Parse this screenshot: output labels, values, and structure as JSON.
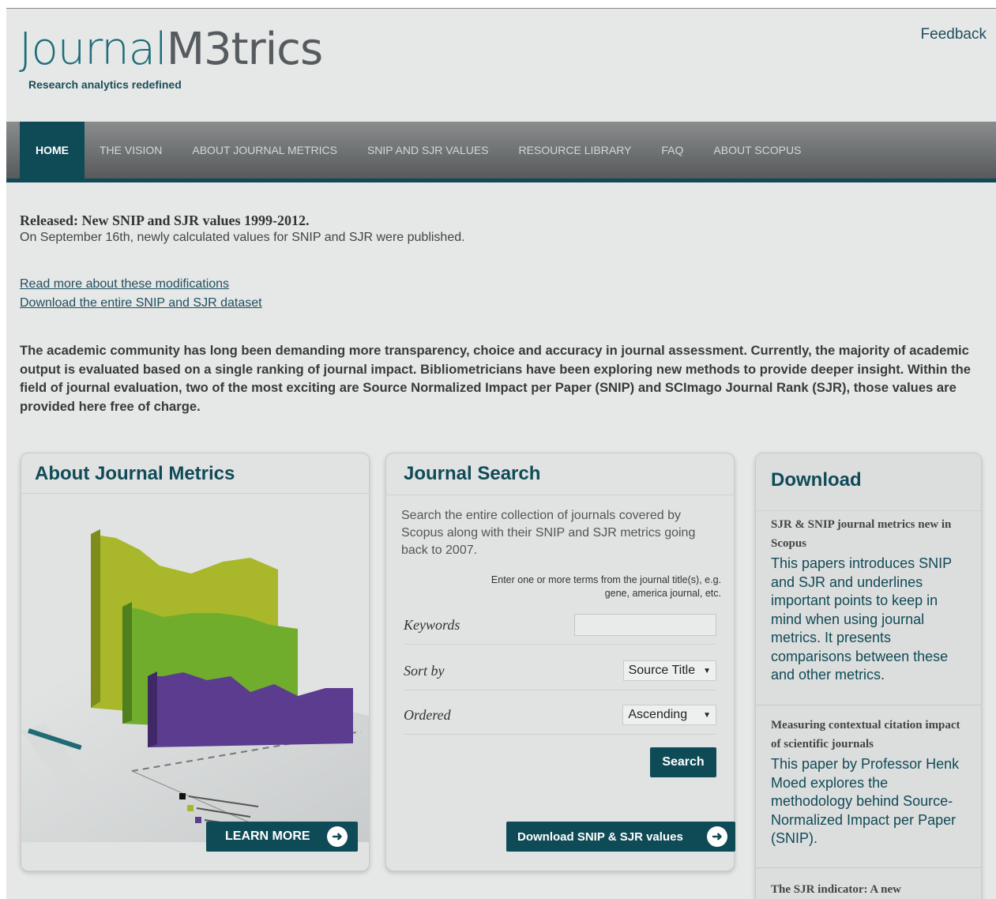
{
  "header": {
    "logo_part1": "Journal",
    "logo_part2": "M3trics",
    "tagline": "Research analytics redefined",
    "feedback": "Feedback"
  },
  "nav": {
    "items": [
      "HOME",
      "THE VISION",
      "ABOUT JOURNAL METRICS",
      "SNIP AND SJR VALUES",
      "RESOURCE LIBRARY",
      "FAQ",
      "ABOUT SCOPUS"
    ],
    "active": "HOME"
  },
  "intro": {
    "release_title": "Released: New SNIP and SJR values 1999-2012.",
    "release_text": "On September 16th, newly calculated values for SNIP and SJR were published.",
    "link1": "Read more about these modifications",
    "link2": "Download the entire SNIP and SJR dataset",
    "description": "The academic community has long been demanding more transparency, choice and accuracy in journal assessment. Currently, the majority of academic output is evaluated based on a single ranking of journal impact. Bibliometricians have been exploring new methods to provide deeper insight. Within the field of journal evaluation, two of the most exciting are Source Normalized Impact per Paper (SNIP) and SCImago Journal Rank (SJR), those values are provided here free of charge."
  },
  "about_panel": {
    "title": "About Journal Metrics",
    "button": "LEARN MORE"
  },
  "search_panel": {
    "title": "Journal Search",
    "description": "Search the entire collection of journals covered by Scopus along with their SNIP and SJR metrics going back to 2007.",
    "hint": "Enter one or more terms from the journal title(s), e.g. gene, america journal, etc.",
    "keywords_label": "Keywords",
    "keywords_value": "",
    "sortby_label": "Sort by",
    "sortby_value": "Source Title",
    "ordered_label": "Ordered",
    "ordered_value": "Ascending",
    "search_button": "Search",
    "download_button": "Download SNIP & SJR values"
  },
  "download_panel": {
    "title": "Download",
    "items": [
      {
        "title": "SJR & SNIP journal metrics new in Scopus",
        "desc": "This papers introduces SNIP and SJR and underlines important points to keep in mind when using journal metrics. It presents comparisons between these and other metrics."
      },
      {
        "title": "Measuring contextual citation impact of scientific journals",
        "desc": "This paper by Professor Henk Moed explores the methodology behind Source-Normalized Impact per Paper (SNIP)."
      },
      {
        "title": "The SJR indicator: A new",
        "desc": ""
      }
    ]
  },
  "colors": {
    "brand_teal": "#0f4b57",
    "bar_green1": "#a8b82a",
    "bar_green2": "#6fa82a",
    "bar_purple": "#5b3c8f"
  }
}
